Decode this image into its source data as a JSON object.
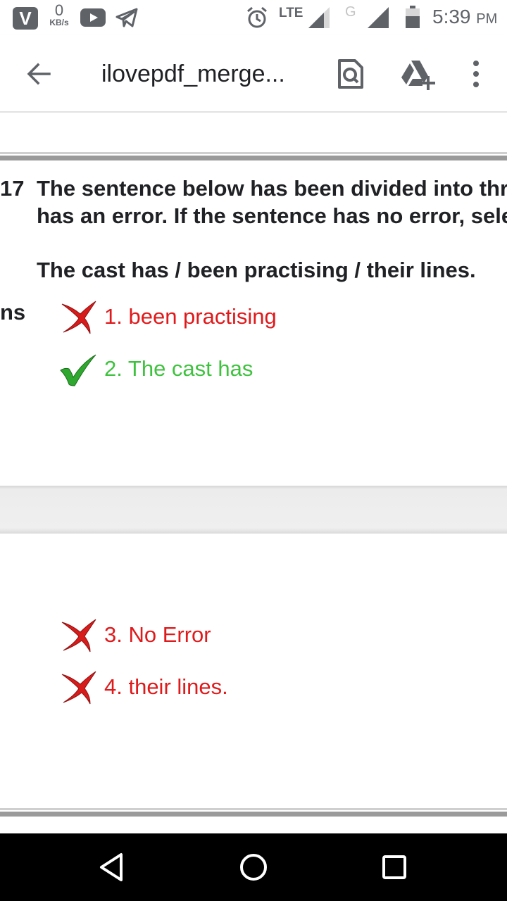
{
  "status_bar": {
    "carrier_badge": "V",
    "net_speed_value": "0",
    "net_speed_unit": "KB/s",
    "network_type": "LTE",
    "second_network": "G",
    "time": "5:39",
    "ampm": "PM",
    "battery_level": 0.6
  },
  "app_bar": {
    "title": "ilovepdf_merge..."
  },
  "document": {
    "question_number": "17",
    "question_lines": [
      "The sentence below has been divided into thr",
      "has an error. If the sentence has no error, sele",
      "The cast has / been practising / their lines."
    ],
    "side_fragment": "ns",
    "options": [
      {
        "label": "1. been practising",
        "status": "wrong"
      },
      {
        "label": "2. The cast has",
        "status": "correct"
      },
      {
        "label": "3. No Error",
        "status": "wrong"
      },
      {
        "label": "4. their lines.",
        "status": "wrong"
      }
    ]
  },
  "colors": {
    "wrong": "#e0191b",
    "correct": "#3ec23e",
    "icon_gray": "#5f6368"
  },
  "icons": {
    "back": "arrow-back-icon",
    "find": "find-in-page-icon",
    "drive": "add-to-drive-icon",
    "more": "more-vert-icon",
    "wrong": "red-cross-icon",
    "correct": "green-check-icon",
    "nav_back": "nav-back-icon",
    "nav_home": "nav-home-icon",
    "nav_recent": "nav-recent-icon"
  }
}
